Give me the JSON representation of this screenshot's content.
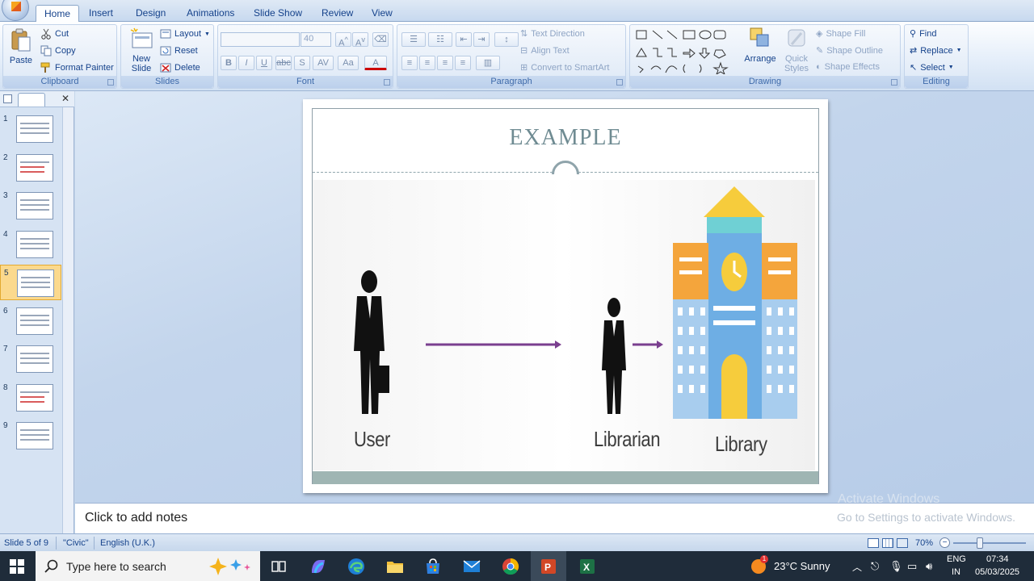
{
  "tabs": [
    "Home",
    "Insert",
    "Design",
    "Animations",
    "Slide Show",
    "Review",
    "View"
  ],
  "ribbon": {
    "clipboard": {
      "label": "Clipboard",
      "paste": "Paste",
      "cut": "Cut",
      "copy": "Copy",
      "format_painter": "Format Painter"
    },
    "slides": {
      "label": "Slides",
      "new_slide": "New Slide",
      "layout": "Layout",
      "reset": "Reset",
      "delete": "Delete"
    },
    "font": {
      "label": "Font",
      "font_size": "40"
    },
    "paragraph": {
      "label": "Paragraph",
      "text_direction": "Text Direction",
      "align_text": "Align Text",
      "convert_smartart": "Convert to SmartArt"
    },
    "drawing": {
      "label": "Drawing",
      "arrange": "Arrange",
      "quick_styles": "Quick Styles",
      "shape_fill": "Shape Fill",
      "shape_outline": "Shape Outline",
      "shape_effects": "Shape Effects"
    },
    "editing": {
      "label": "Editing",
      "find": "Find",
      "replace": "Replace",
      "select": "Select"
    }
  },
  "slides_pane": {
    "numbers": [
      "1",
      "2",
      "3",
      "4",
      "5",
      "6",
      "7",
      "8",
      "9"
    ],
    "selected_index": 5
  },
  "slide": {
    "title": "EXAMPLE",
    "labels": {
      "user": "User",
      "librarian": "Librarian",
      "library": "Library"
    }
  },
  "watermark": {
    "line1": "Activate Windows",
    "line2": "Go to Settings to activate Windows."
  },
  "notes": {
    "placeholder": "Click to add notes"
  },
  "status": {
    "slide": "Slide 5 of 9",
    "theme": "\"Civic\"",
    "language": "English (U.K.)",
    "zoom": "70%",
    "zoom_level": 0.7
  },
  "taskbar": {
    "search_placeholder": "Type here to search",
    "weather": "23°C  Sunny",
    "lang1": "ENG",
    "lang2": "IN",
    "time": "07:34",
    "date": "05/03/2025",
    "notification_count": "1"
  },
  "colors": {
    "accent": "#15428b",
    "title_gray": "#6f8b92",
    "arrow_purple": "#7a3f8f",
    "selection": "#fbd98d"
  }
}
